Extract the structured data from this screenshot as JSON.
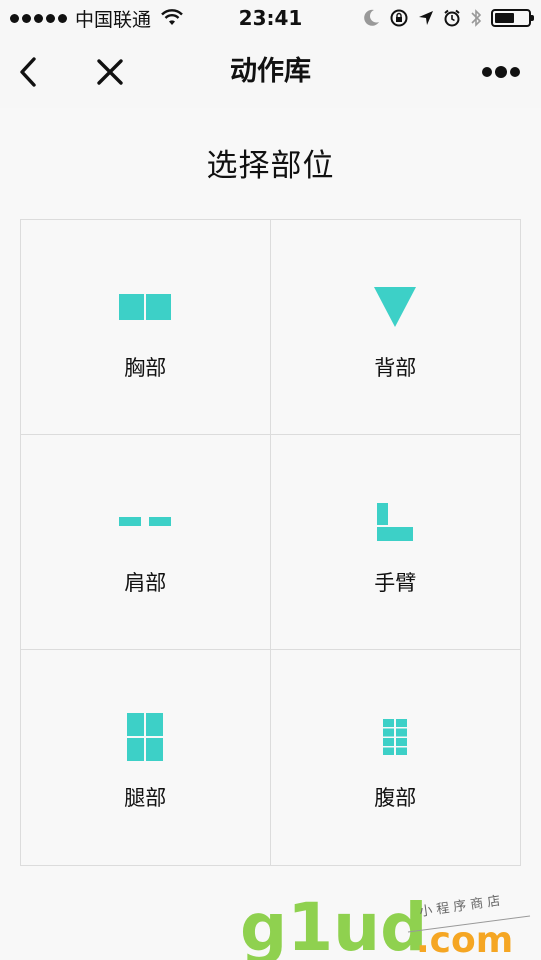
{
  "status_bar": {
    "carrier": "中国联通",
    "time": "23:41"
  },
  "nav": {
    "title": "动作库"
  },
  "page": {
    "heading": "选择部位"
  },
  "parts": [
    {
      "label": "胸部",
      "icon": "chest-icon"
    },
    {
      "label": "背部",
      "icon": "back-icon"
    },
    {
      "label": "肩部",
      "icon": "shoulder-icon"
    },
    {
      "label": "手臂",
      "icon": "arm-icon"
    },
    {
      "label": "腿部",
      "icon": "leg-icon"
    },
    {
      "label": "腹部",
      "icon": "abs-icon"
    }
  ],
  "watermark": {
    "brand": "g1ud",
    "suffix": ".com",
    "tagline": "小 程 序 商 店"
  },
  "colors": {
    "accent": "#3dd0c7",
    "watermark_green": "#8fd14f",
    "watermark_orange": "#f5a623"
  }
}
